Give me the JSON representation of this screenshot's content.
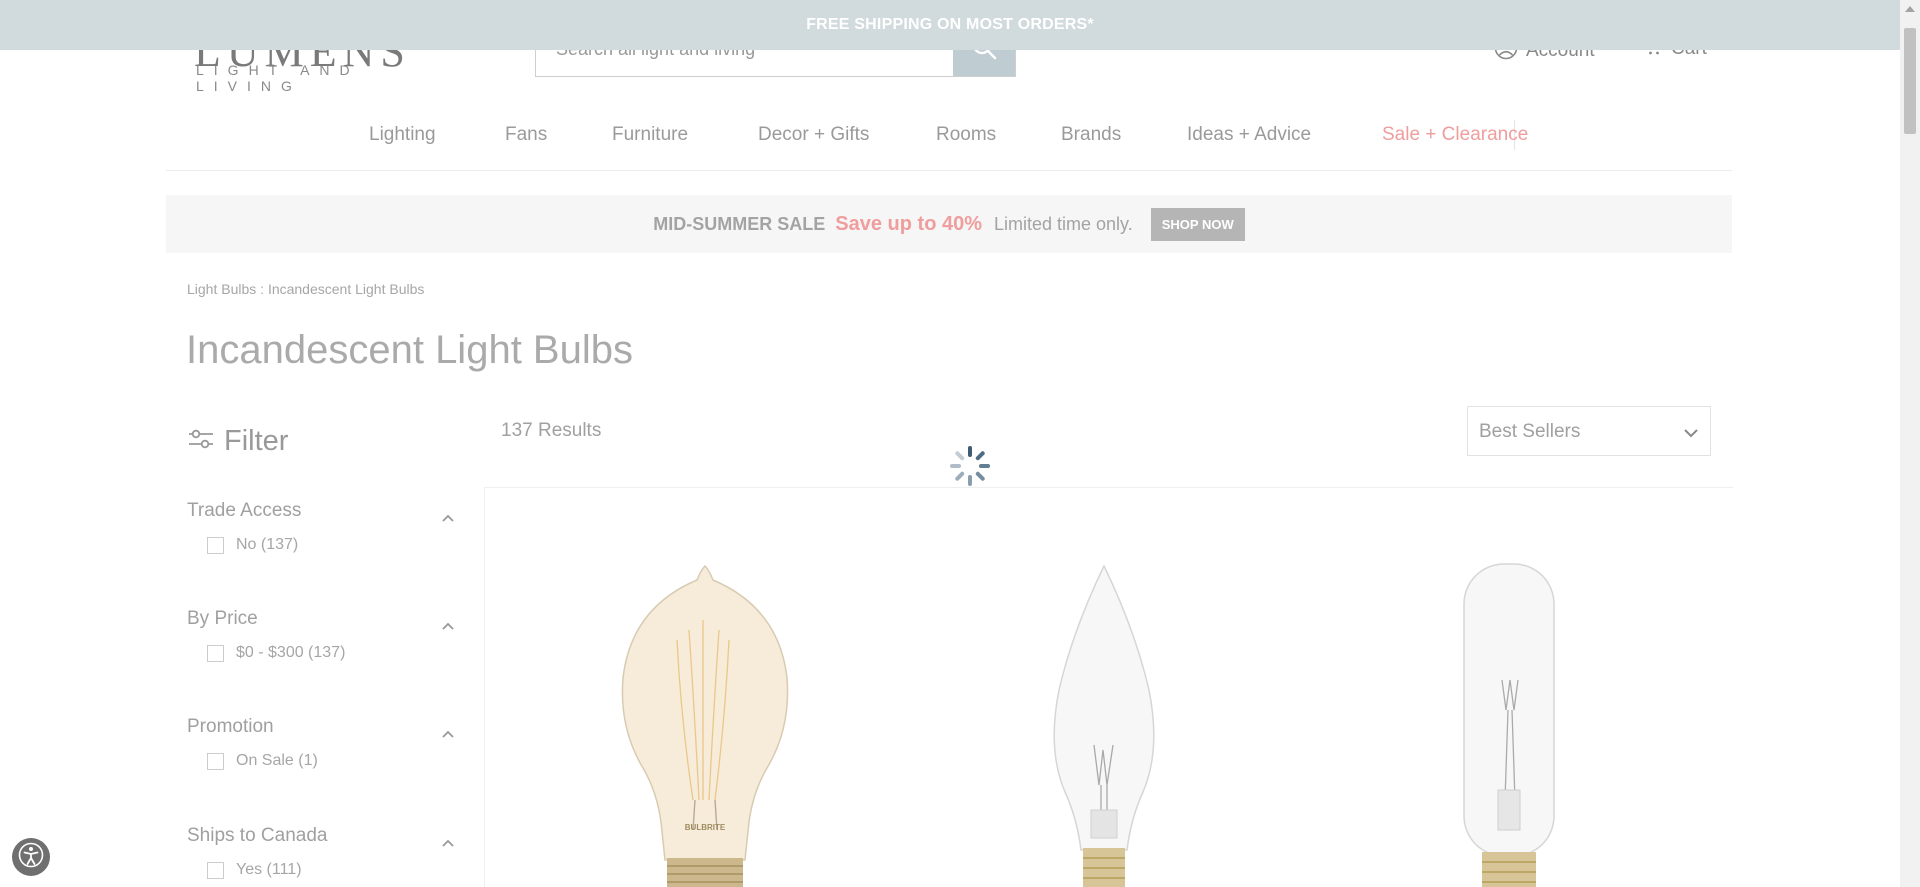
{
  "banner": {
    "text": "FREE SHIPPING ON MOST ORDERS*"
  },
  "header": {
    "logo_word": "LUMENS",
    "logo_sub": "LIGHT AND LIVING",
    "search_placeholder": "Search all light and living",
    "account_label": "Account",
    "cart_label": "Cart"
  },
  "nav": {
    "items": [
      "Lighting",
      "Fans",
      "Furniture",
      "Decor + Gifts",
      "Rooms",
      "Brands",
      "Ideas + Advice"
    ],
    "sale_label": "Sale + Clearance"
  },
  "promo": {
    "label": "MID-SUMMER SALE",
    "highlight": "Save up to 40%",
    "note": "Limited time only.",
    "button": "SHOP NOW"
  },
  "breadcrumb": {
    "text": "Light Bulbs : Incandescent Light Bulbs"
  },
  "page": {
    "title": "Incandescent Light Bulbs"
  },
  "filter": {
    "heading": "Filter",
    "groups": [
      {
        "title": "Trade Access",
        "option": "No (137)"
      },
      {
        "title": "By Price",
        "option": "$0 - $300 (137)"
      },
      {
        "title": "Promotion",
        "option": "On Sale (1)"
      },
      {
        "title": "Ships to Canada",
        "option": "Yes (111)"
      }
    ]
  },
  "results": {
    "count": "137 Results",
    "sort_value": "Best Sellers"
  },
  "products": [
    {
      "bulb_brand": "BULBRITE"
    },
    {
      "bulb_brand": ""
    },
    {
      "bulb_brand": ""
    }
  ],
  "colors": {
    "banner_bg": "#d1dadd",
    "sale_text": "#ef9d9d",
    "search_button": "#bfcdd2"
  }
}
